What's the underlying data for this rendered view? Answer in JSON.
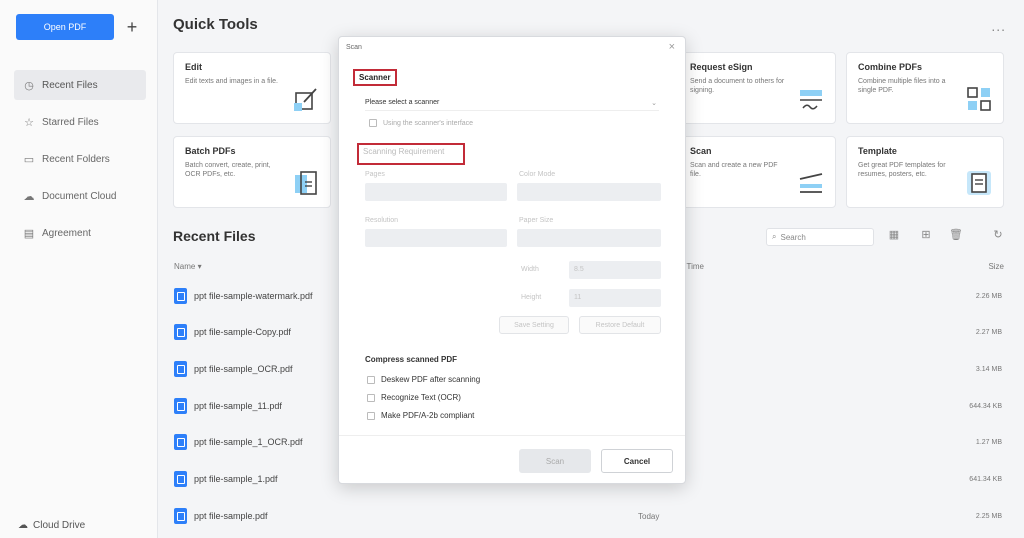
{
  "sidebar": {
    "open_pdf": "Open PDF",
    "plus": "+",
    "items": [
      {
        "label": "Recent Files",
        "icon": "clock-icon"
      },
      {
        "label": "Starred Files",
        "icon": "star-icon"
      },
      {
        "label": "Recent Folders",
        "icon": "folder-icon"
      },
      {
        "label": "Document Cloud",
        "icon": "cloud-icon"
      },
      {
        "label": "Agreement",
        "icon": "document-icon"
      }
    ],
    "cloud_drive": "Cloud Drive"
  },
  "quick_tools": {
    "title": "Quick Tools",
    "more": "...",
    "cards": [
      {
        "title": "Edit",
        "desc": "Edit texts and images in a file."
      },
      {
        "title": "Request eSign",
        "desc": "Send a document to others for signing."
      },
      {
        "title": "Combine PDFs",
        "desc": "Combine multiple files into a single PDF."
      },
      {
        "title": "Batch PDFs",
        "desc": "Batch convert, create, print, OCR PDFs, etc."
      },
      {
        "title": "Scan",
        "desc": "Scan and create a new PDF file."
      },
      {
        "title": "Template",
        "desc": "Get great PDF templates for resumes, posters, etc."
      }
    ]
  },
  "recent_files": {
    "title": "Recent Files",
    "search_placeholder": "Search",
    "columns": {
      "name": "Name ▾",
      "time": "d Time",
      "size": "Size"
    },
    "rows": [
      {
        "name": "ppt file-sample-watermark.pdf",
        "time": "",
        "size": "2.26 MB"
      },
      {
        "name": "ppt file-sample-Copy.pdf",
        "time": "",
        "size": "2.27 MB"
      },
      {
        "name": "ppt file-sample_OCR.pdf",
        "time": "",
        "size": "3.14 MB"
      },
      {
        "name": "ppt file-sample_11.pdf",
        "time": "",
        "size": "644.34 KB"
      },
      {
        "name": "ppt file-sample_1_OCR.pdf",
        "time": "",
        "size": "1.27 MB"
      },
      {
        "name": "ppt file-sample_1.pdf",
        "time": "",
        "size": "641.34 KB"
      },
      {
        "name": "ppt file-sample.pdf",
        "time": "Today",
        "size": "2.25 MB"
      }
    ]
  },
  "dialog": {
    "title": "Scan",
    "close": "×",
    "scanner_label": "Scanner",
    "scanner_select": "Please select a scanner",
    "use_interface": "Using the scanner's interface",
    "scanning_requirement": "Scanning Requirement",
    "pages_label": "Pages",
    "color_mode_label": "Color Mode",
    "resolution_label": "Resolution",
    "paper_size_label": "Paper Size",
    "width_label": "Width",
    "width_value": "8.5",
    "height_label": "Height",
    "height_value": "11",
    "save_setting": "Save Setting",
    "restore_default": "Restore Default",
    "compress_title": "Compress scanned PDF",
    "options": [
      "Deskew PDF after scanning",
      "Recognize Text (OCR)",
      "Make PDF/A-2b compliant"
    ],
    "ok": "Scan",
    "cancel": "Cancel"
  },
  "colors": {
    "accent": "#2d7ff9",
    "highlight": "#c22b38"
  }
}
